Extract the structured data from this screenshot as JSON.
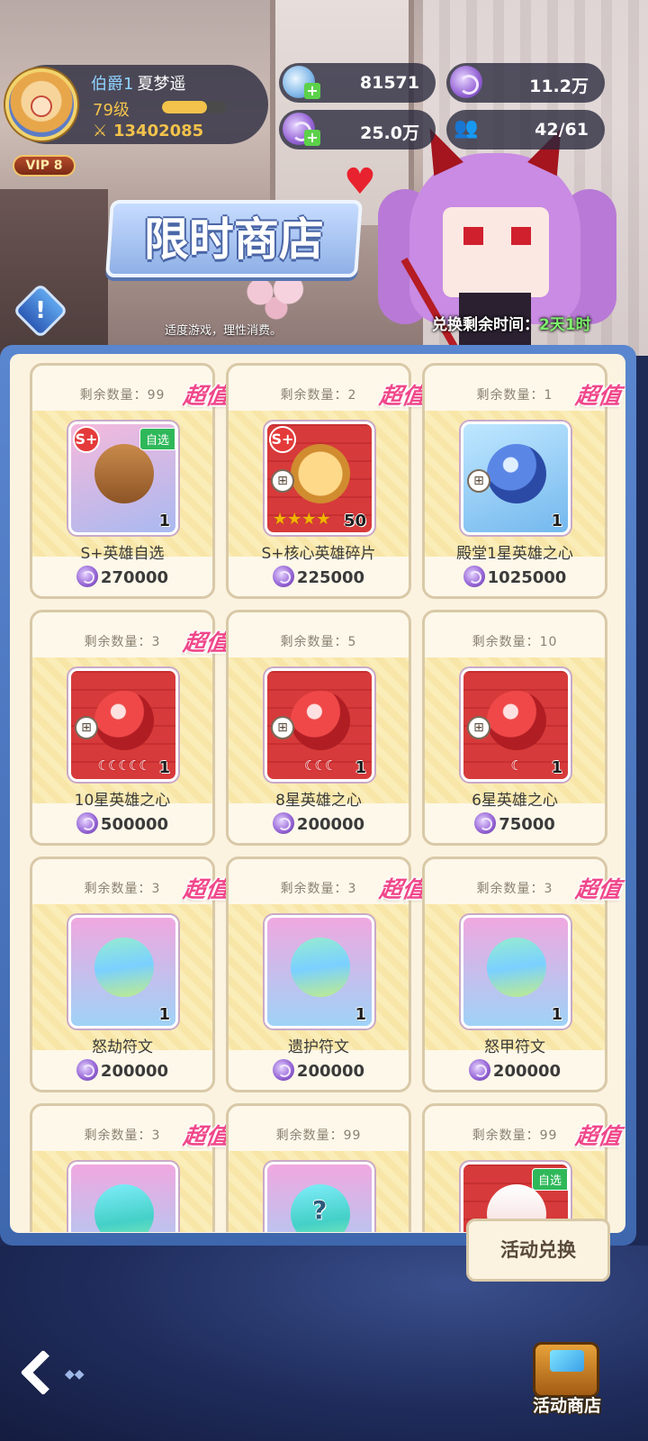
{
  "player": {
    "title": "伯爵1",
    "name": "夏梦遥",
    "level": "79级",
    "level_progress": 0.7,
    "power": "13402085",
    "vip": "VIP 8"
  },
  "currencies": {
    "gems": "81571",
    "coins_top": "11.2万",
    "coins": "25.0万",
    "population": "42/61"
  },
  "shop": {
    "title": "限时商店",
    "notice": "适度游戏，理性消费。",
    "time_label": "兑换剩余时间：",
    "time_value": "2天1时"
  },
  "items": [
    {
      "remain": "剩余数量：99",
      "deal": "超值",
      "name": "S+英雄自选",
      "price": "270000",
      "qty": "1",
      "badge": "S+",
      "tag": "自选"
    },
    {
      "remain": "剩余数量：2",
      "deal": "超值",
      "name": "S+核心英雄碎片",
      "price": "225000",
      "qty": "50",
      "badge": "S+",
      "stars": "★★★★"
    },
    {
      "remain": "剩余数量：1",
      "deal": "超值",
      "name": "殿堂1星英雄之心",
      "price": "1025000",
      "qty": "1"
    },
    {
      "remain": "剩余数量：3",
      "deal": "超值",
      "name": "10星英雄之心",
      "price": "500000",
      "qty": "1",
      "moons": "☾☾☾☾☾"
    },
    {
      "remain": "剩余数量：5",
      "deal": "",
      "name": "8星英雄之心",
      "price": "200000",
      "qty": "1",
      "moons": "☾☾☾"
    },
    {
      "remain": "剩余数量：10",
      "deal": "",
      "name": "6星英雄之心",
      "price": "75000",
      "qty": "1",
      "moons": "☾"
    },
    {
      "remain": "剩余数量：3",
      "deal": "超值",
      "name": "怒劫符文",
      "price": "200000",
      "qty": "1"
    },
    {
      "remain": "剩余数量：3",
      "deal": "超值",
      "name": "遗护符文",
      "price": "200000",
      "qty": "1"
    },
    {
      "remain": "剩余数量：3",
      "deal": "超值",
      "name": "怒甲符文",
      "price": "200000",
      "qty": "1"
    },
    {
      "remain": "剩余数量：3",
      "deal": "超值",
      "name": "",
      "price": "",
      "qty": ""
    },
    {
      "remain": "剩余数量：99",
      "deal": "",
      "name": "",
      "price": "",
      "qty": "",
      "mystery": "?"
    },
    {
      "remain": "剩余数量：99",
      "deal": "超值",
      "name": "",
      "price": "",
      "qty": "",
      "tag": "自选"
    }
  ],
  "grid_icon": "⊞",
  "bottom": {
    "exchange_tab": "活动兑换",
    "shop_button": "活动商店"
  }
}
